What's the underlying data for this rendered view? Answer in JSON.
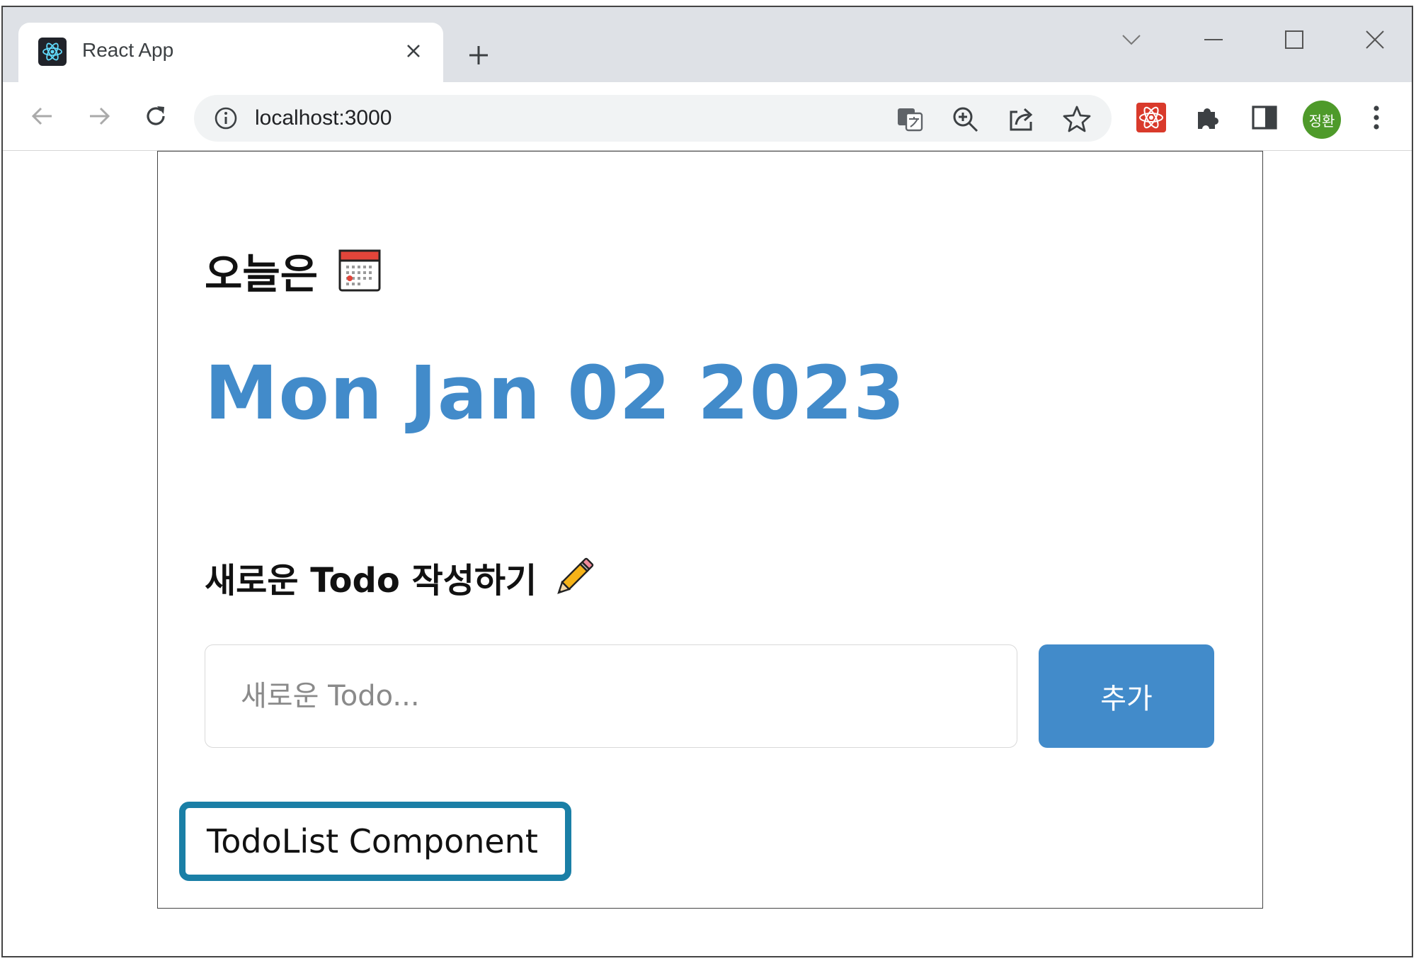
{
  "browser": {
    "tab_title": "React App",
    "url": "localhost:3000",
    "profile_initials": "정환",
    "icons": {
      "favicon": "react-logo-icon",
      "close": "close-icon",
      "new_tab": "plus-icon",
      "tab_search": "chevron-down-icon",
      "minimize": "minimize-icon",
      "maximize": "maximize-icon",
      "window_close": "close-icon",
      "back": "arrow-left-icon",
      "forward": "arrow-right-icon",
      "reload": "reload-icon",
      "site_info": "info-icon",
      "translate": "translate-icon",
      "zoom": "zoom-in-icon",
      "share": "share-icon",
      "bookmark": "star-icon",
      "react_devtools": "react-devtools-icon",
      "extensions": "puzzle-icon",
      "side_panel": "side-panel-icon",
      "menu": "kebab-menu-icon"
    }
  },
  "app": {
    "header": {
      "today_label": "오늘은",
      "date": "Mon Jan 02 2023"
    },
    "editor": {
      "title": "새로운 Todo 작성하기",
      "input_placeholder": "새로운 Todo...",
      "input_value": "",
      "add_button": "추가"
    },
    "todolist": {
      "label": "TodoList Component"
    }
  },
  "colors": {
    "accent": "#428bca",
    "highlight_border": "#1a7fa6",
    "avatar": "#4e9a2a"
  }
}
